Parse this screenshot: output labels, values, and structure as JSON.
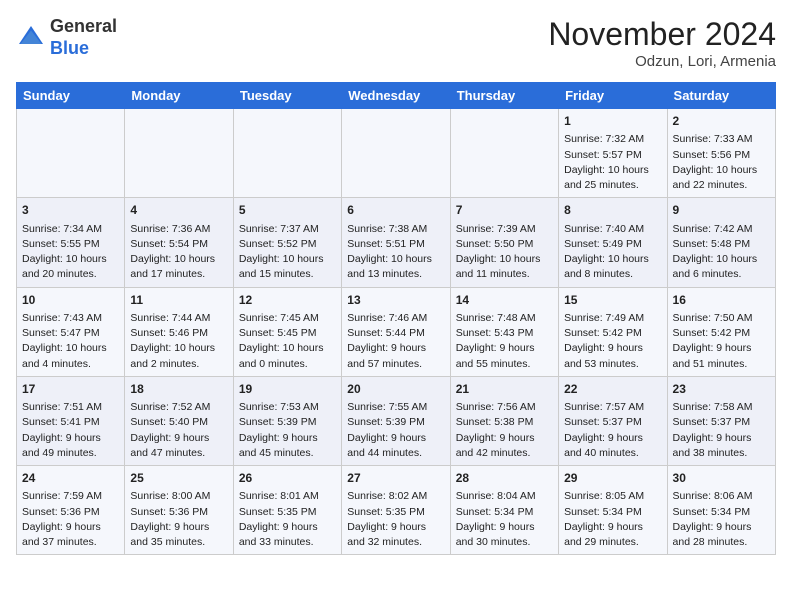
{
  "header": {
    "logo_general": "General",
    "logo_blue": "Blue",
    "month_title": "November 2024",
    "location": "Odzun, Lori, Armenia"
  },
  "days_of_week": [
    "Sunday",
    "Monday",
    "Tuesday",
    "Wednesday",
    "Thursday",
    "Friday",
    "Saturday"
  ],
  "weeks": [
    [
      {
        "day": "",
        "info": ""
      },
      {
        "day": "",
        "info": ""
      },
      {
        "day": "",
        "info": ""
      },
      {
        "day": "",
        "info": ""
      },
      {
        "day": "",
        "info": ""
      },
      {
        "day": "1",
        "info": "Sunrise: 7:32 AM\nSunset: 5:57 PM\nDaylight: 10 hours and 25 minutes."
      },
      {
        "day": "2",
        "info": "Sunrise: 7:33 AM\nSunset: 5:56 PM\nDaylight: 10 hours and 22 minutes."
      }
    ],
    [
      {
        "day": "3",
        "info": "Sunrise: 7:34 AM\nSunset: 5:55 PM\nDaylight: 10 hours and 20 minutes."
      },
      {
        "day": "4",
        "info": "Sunrise: 7:36 AM\nSunset: 5:54 PM\nDaylight: 10 hours and 17 minutes."
      },
      {
        "day": "5",
        "info": "Sunrise: 7:37 AM\nSunset: 5:52 PM\nDaylight: 10 hours and 15 minutes."
      },
      {
        "day": "6",
        "info": "Sunrise: 7:38 AM\nSunset: 5:51 PM\nDaylight: 10 hours and 13 minutes."
      },
      {
        "day": "7",
        "info": "Sunrise: 7:39 AM\nSunset: 5:50 PM\nDaylight: 10 hours and 11 minutes."
      },
      {
        "day": "8",
        "info": "Sunrise: 7:40 AM\nSunset: 5:49 PM\nDaylight: 10 hours and 8 minutes."
      },
      {
        "day": "9",
        "info": "Sunrise: 7:42 AM\nSunset: 5:48 PM\nDaylight: 10 hours and 6 minutes."
      }
    ],
    [
      {
        "day": "10",
        "info": "Sunrise: 7:43 AM\nSunset: 5:47 PM\nDaylight: 10 hours and 4 minutes."
      },
      {
        "day": "11",
        "info": "Sunrise: 7:44 AM\nSunset: 5:46 PM\nDaylight: 10 hours and 2 minutes."
      },
      {
        "day": "12",
        "info": "Sunrise: 7:45 AM\nSunset: 5:45 PM\nDaylight: 10 hours and 0 minutes."
      },
      {
        "day": "13",
        "info": "Sunrise: 7:46 AM\nSunset: 5:44 PM\nDaylight: 9 hours and 57 minutes."
      },
      {
        "day": "14",
        "info": "Sunrise: 7:48 AM\nSunset: 5:43 PM\nDaylight: 9 hours and 55 minutes."
      },
      {
        "day": "15",
        "info": "Sunrise: 7:49 AM\nSunset: 5:42 PM\nDaylight: 9 hours and 53 minutes."
      },
      {
        "day": "16",
        "info": "Sunrise: 7:50 AM\nSunset: 5:42 PM\nDaylight: 9 hours and 51 minutes."
      }
    ],
    [
      {
        "day": "17",
        "info": "Sunrise: 7:51 AM\nSunset: 5:41 PM\nDaylight: 9 hours and 49 minutes."
      },
      {
        "day": "18",
        "info": "Sunrise: 7:52 AM\nSunset: 5:40 PM\nDaylight: 9 hours and 47 minutes."
      },
      {
        "day": "19",
        "info": "Sunrise: 7:53 AM\nSunset: 5:39 PM\nDaylight: 9 hours and 45 minutes."
      },
      {
        "day": "20",
        "info": "Sunrise: 7:55 AM\nSunset: 5:39 PM\nDaylight: 9 hours and 44 minutes."
      },
      {
        "day": "21",
        "info": "Sunrise: 7:56 AM\nSunset: 5:38 PM\nDaylight: 9 hours and 42 minutes."
      },
      {
        "day": "22",
        "info": "Sunrise: 7:57 AM\nSunset: 5:37 PM\nDaylight: 9 hours and 40 minutes."
      },
      {
        "day": "23",
        "info": "Sunrise: 7:58 AM\nSunset: 5:37 PM\nDaylight: 9 hours and 38 minutes."
      }
    ],
    [
      {
        "day": "24",
        "info": "Sunrise: 7:59 AM\nSunset: 5:36 PM\nDaylight: 9 hours and 37 minutes."
      },
      {
        "day": "25",
        "info": "Sunrise: 8:00 AM\nSunset: 5:36 PM\nDaylight: 9 hours and 35 minutes."
      },
      {
        "day": "26",
        "info": "Sunrise: 8:01 AM\nSunset: 5:35 PM\nDaylight: 9 hours and 33 minutes."
      },
      {
        "day": "27",
        "info": "Sunrise: 8:02 AM\nSunset: 5:35 PM\nDaylight: 9 hours and 32 minutes."
      },
      {
        "day": "28",
        "info": "Sunrise: 8:04 AM\nSunset: 5:34 PM\nDaylight: 9 hours and 30 minutes."
      },
      {
        "day": "29",
        "info": "Sunrise: 8:05 AM\nSunset: 5:34 PM\nDaylight: 9 hours and 29 minutes."
      },
      {
        "day": "30",
        "info": "Sunrise: 8:06 AM\nSunset: 5:34 PM\nDaylight: 9 hours and 28 minutes."
      }
    ]
  ]
}
